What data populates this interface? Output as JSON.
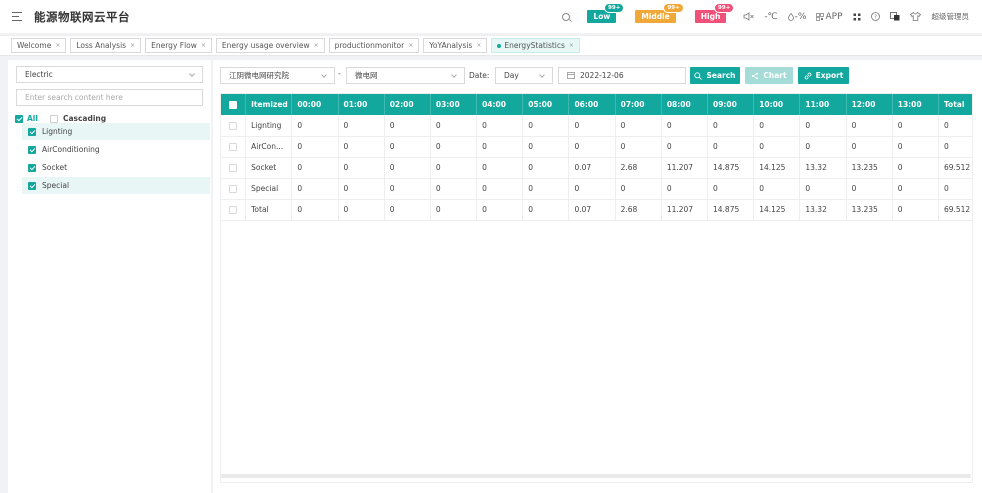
{
  "header": {
    "title": "能源物联网云平台",
    "alarms": [
      {
        "label": "Low",
        "badge": "99+",
        "color": "#13a89e",
        "badge_color": "#13a89e"
      },
      {
        "label": "Middle",
        "badge": "99+",
        "color": "#f0a838",
        "badge_color": "#f0a838"
      },
      {
        "label": "High",
        "badge": "99+",
        "color": "#f0517a",
        "badge_color": "#f0517a"
      }
    ],
    "weather": {
      "temp": "-℃",
      "humidity": "-%"
    },
    "app_label": "APP",
    "user": "超级管理员"
  },
  "tabs": [
    {
      "label": "Welcome",
      "active": false
    },
    {
      "label": "Loss Analysis",
      "active": false
    },
    {
      "label": "Energy Flow",
      "active": false
    },
    {
      "label": "Energy usage overview",
      "active": false
    },
    {
      "label": "productionmonitor",
      "active": false
    },
    {
      "label": "YoYAnalysis",
      "active": false
    },
    {
      "label": "EnergyStatistics",
      "active": true
    }
  ],
  "left": {
    "energy_type": "Electric",
    "search_placeholder": "Enter search content here",
    "all_label": "All",
    "cascading_label": "Cascading",
    "items": [
      {
        "label": "Lignting",
        "selected": true
      },
      {
        "label": "AirConditioning",
        "selected": false
      },
      {
        "label": "Socket",
        "selected": false
      },
      {
        "label": "Special",
        "selected": true
      }
    ]
  },
  "filters": {
    "site": "江阴微电网研究院",
    "network": "微电网",
    "date_label": "Date:",
    "period": "Day",
    "date": "2022-12-06",
    "search_btn": "Search",
    "chart_btn": "Chart",
    "export_btn": "Export"
  },
  "table": {
    "columns": [
      "Itemized",
      "00:00",
      "01:00",
      "02:00",
      "03:00",
      "04:00",
      "05:00",
      "06:00",
      "07:00",
      "08:00",
      "09:00",
      "10:00",
      "11:00",
      "12:00",
      "13:00",
      "Total"
    ],
    "rows": [
      [
        "Lignting",
        "0",
        "0",
        "0",
        "0",
        "0",
        "0",
        "0",
        "0",
        "0",
        "0",
        "0",
        "0",
        "0",
        "0",
        "0"
      ],
      [
        "AirCon...",
        "0",
        "0",
        "0",
        "0",
        "0",
        "0",
        "0",
        "0",
        "0",
        "0",
        "0",
        "0",
        "0",
        "0",
        "0"
      ],
      [
        "Socket",
        "0",
        "0",
        "0",
        "0",
        "0",
        "0",
        "0.07",
        "2.68",
        "11.207",
        "14.875",
        "14.125",
        "13.32",
        "13.235",
        "0",
        "69.512"
      ],
      [
        "Special",
        "0",
        "0",
        "0",
        "0",
        "0",
        "0",
        "0",
        "0",
        "0",
        "0",
        "0",
        "0",
        "0",
        "0",
        "0"
      ],
      [
        "Total",
        "0",
        "0",
        "0",
        "0",
        "0",
        "0",
        "0.07",
        "2.68",
        "11.207",
        "14.875",
        "14.125",
        "13.32",
        "13.235",
        "0",
        "69.512"
      ]
    ]
  },
  "colors": {
    "accent": "#13a89e"
  }
}
